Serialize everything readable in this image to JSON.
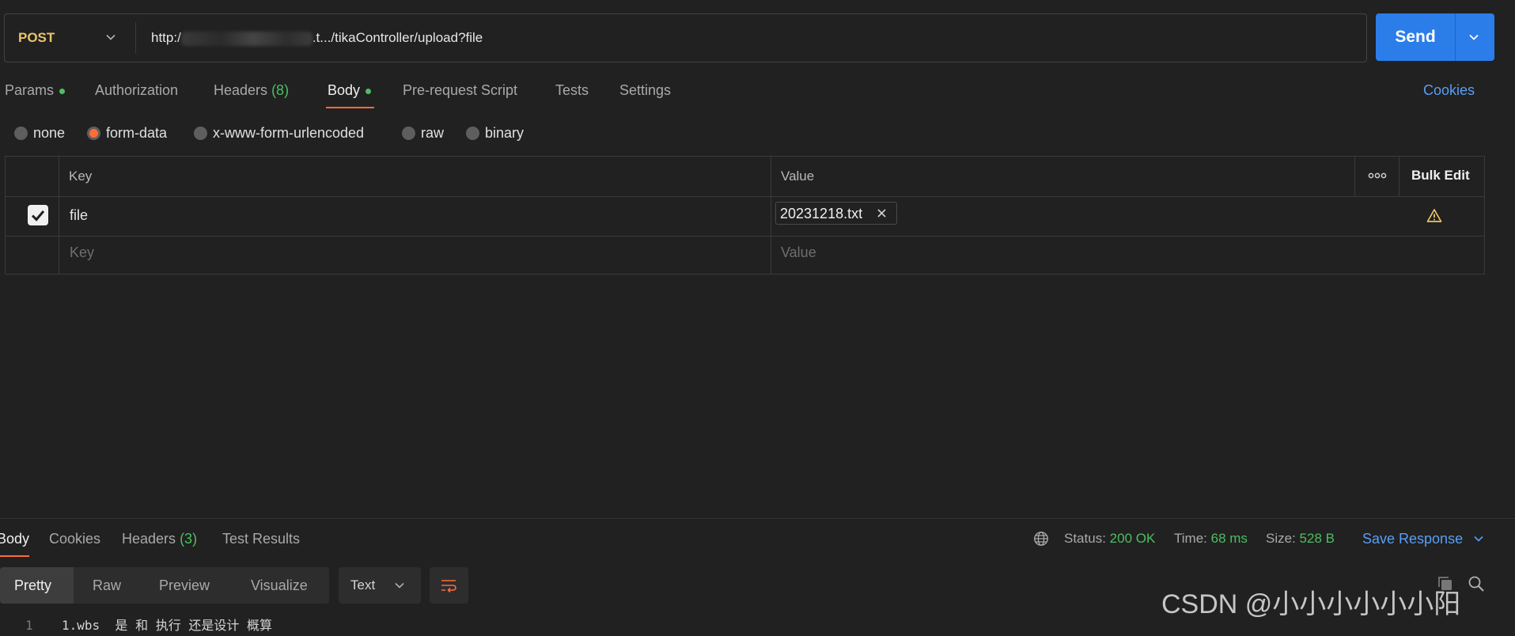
{
  "request": {
    "method": "POST",
    "url_prefix": "http:/",
    "url_suffix": ".t.../tikaController/upload?file",
    "send_label": "Send"
  },
  "tabs": [
    {
      "label": "Params"
    },
    {
      "label": "Authorization"
    },
    {
      "label": "Headers",
      "count": "(8)"
    },
    {
      "label": "Body"
    },
    {
      "label": "Pre-request Script"
    },
    {
      "label": "Tests"
    },
    {
      "label": "Settings"
    }
  ],
  "cookies_label": "Cookies",
  "body_types": [
    "none",
    "form-data",
    "x-www-form-urlencoded",
    "raw",
    "binary"
  ],
  "body_type_selected": "form-data",
  "table": {
    "headers": {
      "key": "Key",
      "value": "Value",
      "bulk_edit": "Bulk Edit"
    },
    "rows": [
      {
        "key": "file",
        "file": "20231218.txt",
        "checked": true
      }
    ],
    "placeholder": {
      "key": "Key",
      "value": "Value"
    }
  },
  "response": {
    "tabs": [
      {
        "label": "Body"
      },
      {
        "label": "Cookies"
      },
      {
        "label": "Headers",
        "count": "(3)"
      },
      {
        "label": "Test Results"
      }
    ],
    "status_label": "Status:",
    "status_value": "200 OK",
    "time_label": "Time:",
    "time_value": "68 ms",
    "size_label": "Size:",
    "size_value": "528 B",
    "save_label": "Save Response",
    "formats": [
      "Pretty",
      "Raw",
      "Preview",
      "Visualize"
    ],
    "format_type": "Text",
    "code": [
      {
        "line": "1",
        "text": "1.wbs  是 和 执行 还是设计 概算"
      }
    ]
  },
  "watermark": "CSDN @小小小小小小阳",
  "colors": {
    "accent": "#ff6c37",
    "send": "#2b7de9",
    "success": "#4cbf62",
    "link": "#5a9ef5",
    "method": "#e9c46a"
  }
}
